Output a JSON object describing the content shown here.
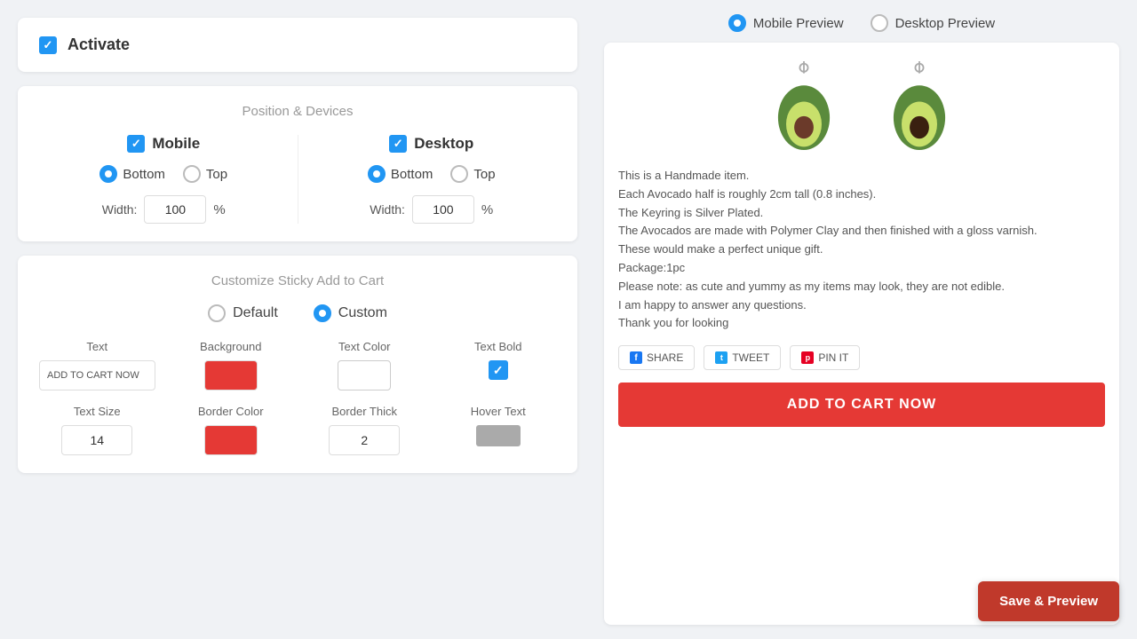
{
  "left": {
    "activate": {
      "label": "Activate",
      "checked": true
    },
    "position": {
      "title": "Position & Devices",
      "mobile": {
        "label": "Mobile",
        "checked": true,
        "position_bottom": true,
        "position_top": false,
        "width_value": "100",
        "width_unit": "%"
      },
      "desktop": {
        "label": "Desktop",
        "checked": true,
        "position_bottom": true,
        "position_top": false,
        "width_value": "100",
        "width_unit": "%"
      },
      "bottom_label": "Bottom",
      "top_label": "Top",
      "width_label": "Width:"
    },
    "customize": {
      "title": "Customize Sticky Add to Cart",
      "default_label": "Default",
      "custom_label": "Custom",
      "custom_selected": true,
      "text": {
        "label": "Text",
        "value": "ADD TO CART NOW"
      },
      "background": {
        "label": "Background",
        "color": "red"
      },
      "text_color": {
        "label": "Text Color",
        "color": "white"
      },
      "text_bold": {
        "label": "Text Bold",
        "checked": true
      },
      "text_size": {
        "label": "Text Size",
        "value": "14"
      },
      "border_color": {
        "label": "Border Color",
        "color": "red"
      },
      "border_thick": {
        "label": "Border Thick",
        "value": "2"
      },
      "hover_text": {
        "label": "Hover Text",
        "color": "gray"
      }
    }
  },
  "right": {
    "preview_toggle": {
      "mobile_label": "Mobile Preview",
      "desktop_label": "Desktop Preview",
      "mobile_selected": true
    },
    "product": {
      "description": "This is a Handmade item.\nEach Avocado half is roughly 2cm tall (0.8 inches).\nThe Keyring is Silver Plated.\nThe Avocados are made with Polymer Clay and then finished with a gloss varnish.\nThese would make a perfect unique gift.\nPackage:1pc\nPlease note: as cute and yummy as my items may look, they are not edible.\nI am happy to answer any questions.\nThank you for looking",
      "social_buttons": [
        {
          "icon": "f",
          "label": "SHARE"
        },
        {
          "icon": "t",
          "label": "TWEET"
        },
        {
          "icon": "p",
          "label": "PIN IT"
        }
      ],
      "add_to_cart_label": "ADD TO CART NOW"
    },
    "save_preview_label": "Save & Preview"
  }
}
